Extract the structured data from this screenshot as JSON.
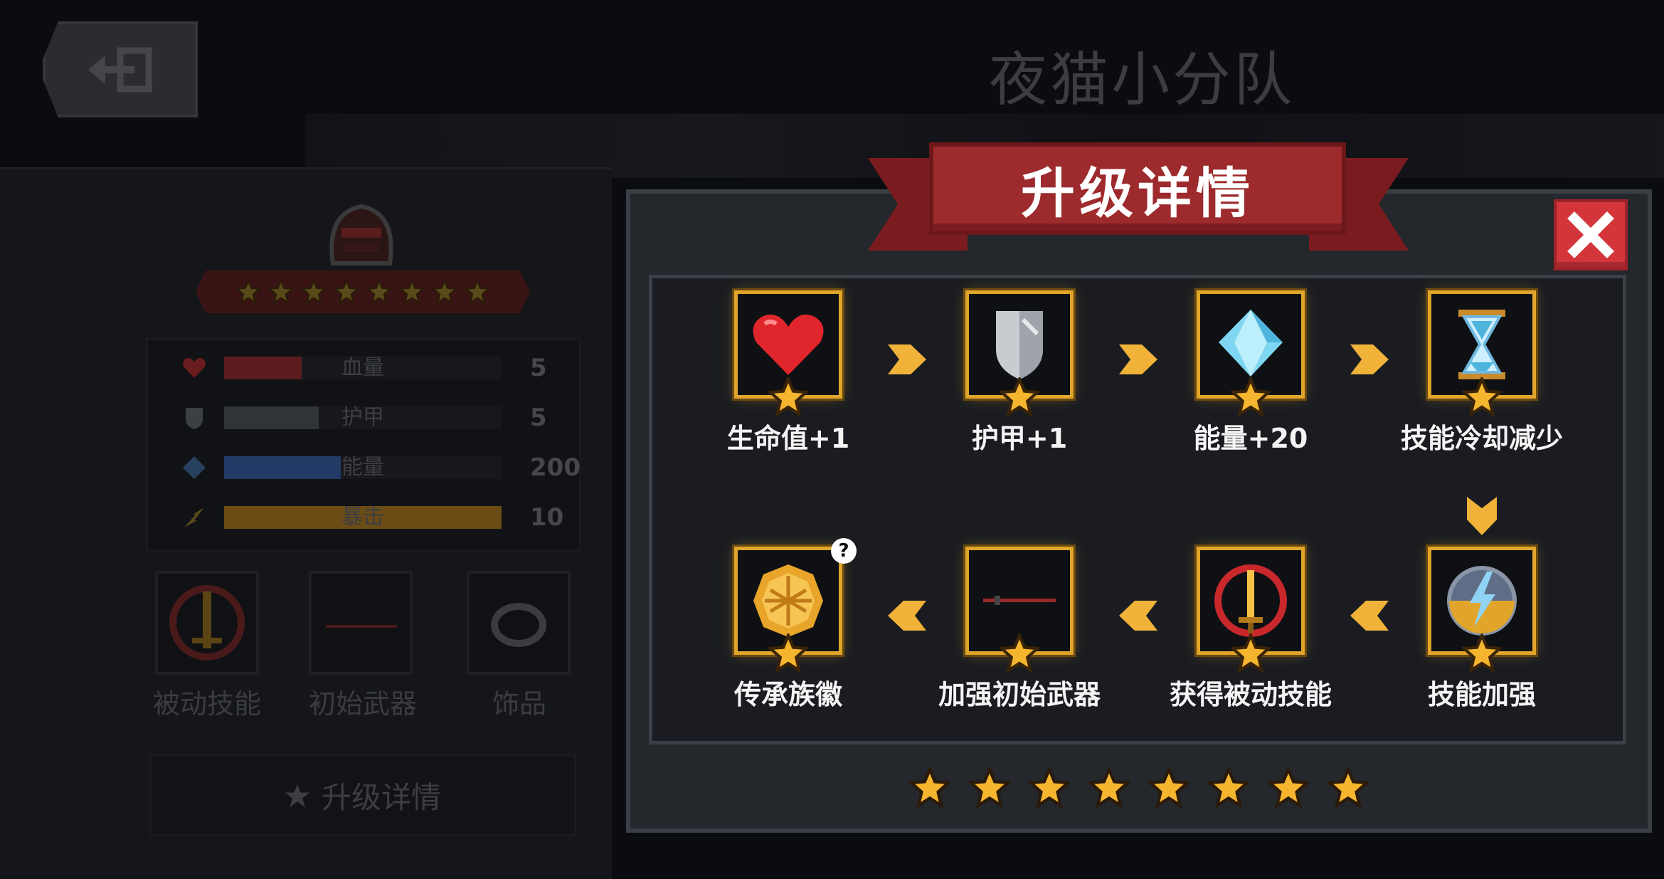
{
  "header": {
    "team_title": "夜猫小分队"
  },
  "hero_panel": {
    "stats": [
      {
        "label": "血量",
        "value": "5",
        "color": "#c0383a",
        "fill": 0.28
      },
      {
        "label": "护甲",
        "value": "5",
        "color": "#6e7378",
        "fill": 0.34
      },
      {
        "label": "能量",
        "value": "200",
        "color": "#3d67c6",
        "fill": 0.42
      },
      {
        "label": "暴击",
        "value": "10",
        "color": "#e0a32b",
        "fill": 1.0
      }
    ],
    "slots": [
      {
        "label": "被动技能",
        "icon": "passive-skill-sword-icon"
      },
      {
        "label": "初始武器",
        "icon": "starting-weapon-icon"
      },
      {
        "label": "饰品",
        "icon": "accessory-ring-icon"
      }
    ],
    "upgrade_button_label": "升级详情",
    "ribbon_star_count": 8
  },
  "modal": {
    "title": "升级详情",
    "nodes": [
      {
        "label": "生命值+1",
        "icon": "heart-icon"
      },
      {
        "label": "护甲+1",
        "icon": "shield-icon"
      },
      {
        "label": "能量+20",
        "icon": "energy-crystal-icon"
      },
      {
        "label": "技能冷却减少",
        "icon": "hourglass-icon"
      },
      {
        "label": "传承族徽",
        "icon": "crest-icon"
      },
      {
        "label": "加强初始武器",
        "icon": "weapon-icon"
      },
      {
        "label": "获得被动技能",
        "icon": "passive-sword-icon"
      },
      {
        "label": "技能加强",
        "icon": "skill-boost-icon"
      }
    ],
    "info_badge": "?",
    "accent_color": "#e0a52a",
    "banner_color": "#9d2a2c"
  }
}
